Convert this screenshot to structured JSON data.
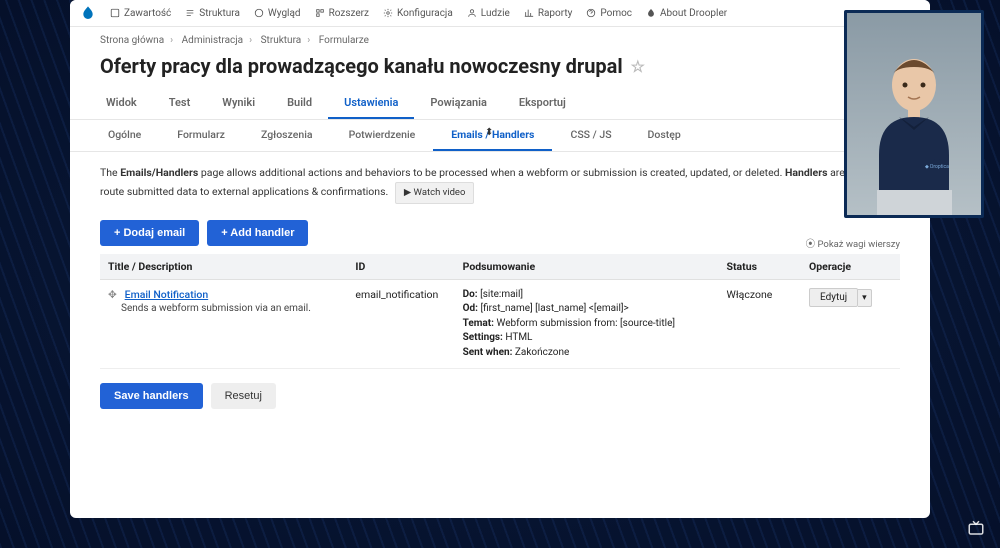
{
  "topnav": {
    "items": [
      {
        "label": "Zawartość"
      },
      {
        "label": "Struktura"
      },
      {
        "label": "Wygląd"
      },
      {
        "label": "Rozszerz"
      },
      {
        "label": "Konfiguracja"
      },
      {
        "label": "Ludzie"
      },
      {
        "label": "Raporty"
      },
      {
        "label": "Pomoc"
      },
      {
        "label": "About Droopler"
      }
    ]
  },
  "breadcrumbs": [
    "Strona główna",
    "Administracja",
    "Struktura",
    "Formularze"
  ],
  "page_title": "Oferty pracy dla prowadzącego kanału nowoczesny drupal",
  "tabs": [
    {
      "label": "Widok"
    },
    {
      "label": "Test"
    },
    {
      "label": "Wyniki"
    },
    {
      "label": "Build"
    },
    {
      "label": "Ustawienia",
      "active": true
    },
    {
      "label": "Powiązania"
    },
    {
      "label": "Eksportuj"
    }
  ],
  "subtabs": [
    {
      "label": "Ogólne"
    },
    {
      "label": "Formularz"
    },
    {
      "label": "Zgłoszenia"
    },
    {
      "label": "Potwierdzenie"
    },
    {
      "label": "Emails / Handlers",
      "active": true
    },
    {
      "label": "CSS / JS"
    },
    {
      "label": "Dostęp"
    }
  ],
  "help": {
    "pre1": "The ",
    "bold1": "Emails/Handlers",
    "mid1": " page allows additional actions and behaviors to be processed when a webform or submission is created, updated, or deleted. ",
    "bold2": "Handlers",
    "post1": " are used to route submitted data to external applications & confirmations.",
    "watch": "▶ Watch video"
  },
  "buttons": {
    "add_email": "+ Dodaj email",
    "add_handler": "+ Add handler",
    "save": "Save handlers",
    "reset": "Resetuj"
  },
  "show_weights": "⦿ Pokaż wagi wierszy",
  "table": {
    "headers": {
      "title": "Title / Description",
      "id": "ID",
      "summary": "Podsumowanie",
      "status": "Status",
      "ops": "Operacje"
    },
    "rows": [
      {
        "title": "Email Notification",
        "desc": "Sends a webform submission via an email.",
        "id": "email_notification",
        "summary": {
          "do_label": "Do:",
          "do": "[site:mail]",
          "od_label": "Od:",
          "od": "[first_name] [last_name] <[email]>",
          "temat_label": "Temat:",
          "temat": "Webform submission from: [source-title]",
          "settings_label": "Settings:",
          "settings": "HTML",
          "sent_label": "Sent when:",
          "sent": "Zakończone"
        },
        "status": "Włączone",
        "op": "Edytuj"
      }
    ]
  }
}
